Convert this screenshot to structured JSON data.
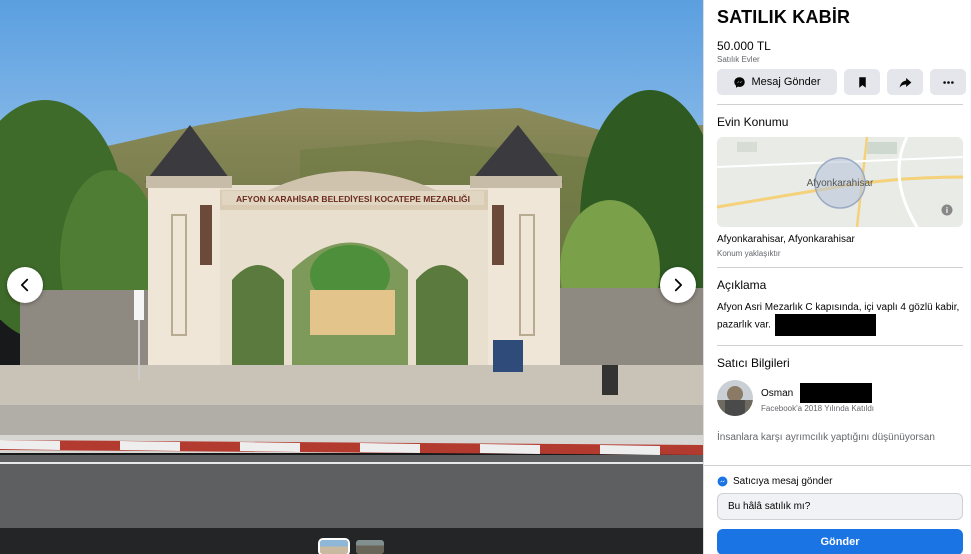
{
  "photo": {
    "sign_text": "AFYON KARAHİSAR BELEDİYESİ KOCATEPE MEZARLIĞI",
    "prev_icon": "chevron-left-icon",
    "next_icon": "chevron-right-icon"
  },
  "listing": {
    "title": "SATILIK KABİR",
    "price": "50.000 TL",
    "category": "Satılık Evler"
  },
  "actions": {
    "message_label": "Mesaj Gönder",
    "message_icon": "messenger-icon",
    "save_icon": "bookmark-icon",
    "share_icon": "share-icon",
    "more_icon": "more-icon"
  },
  "location": {
    "heading": "Evin Konumu",
    "map_label": "Afyonkarahisar",
    "text": "Afyonkarahisar, Afyonkarahisar",
    "sub": "Konum yaklaşıktır"
  },
  "description": {
    "heading": "Açıklama",
    "text": "Afyon Asri Mezarlık C kapısında, içi vaplı 4 gözlü kabir, pazarlık var."
  },
  "seller": {
    "heading": "Satıcı Bilgileri",
    "name": "Osman",
    "joined": "Facebook'a 2018 Yılında Katıldı"
  },
  "report_text": "İnsanlara karşı ayrımcılık yaptığını düşünüyorsan",
  "compose": {
    "heading": "Satıcıya mesaj gönder",
    "input_value": "Bu hâlâ satılık mı?",
    "send_label": "Gönder"
  },
  "colors": {
    "primary": "#1b74e4",
    "button_bg": "#e4e6eb",
    "secondary_text": "#65676b"
  }
}
